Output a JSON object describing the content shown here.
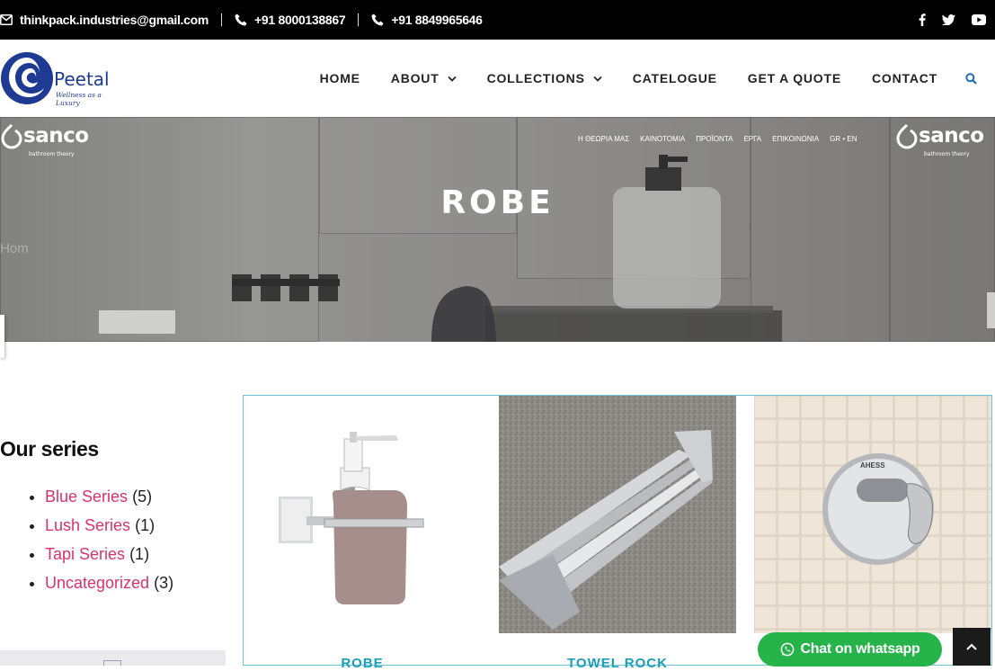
{
  "topbar": {
    "email": "thinkpack.industries@gmail.com",
    "phone1": "+91 8000138867",
    "phone2": "+91 8849965646",
    "icons": [
      "envelope-icon",
      "phone-icon",
      "phone-icon",
      "facebook-icon",
      "twitter-icon",
      "youtube-icon"
    ]
  },
  "logo": {
    "name": "Peetal",
    "tagline": "Wellness as a Luxury"
  },
  "nav": {
    "items": [
      {
        "label": "HOME",
        "dropdown": false
      },
      {
        "label": "ABOUT",
        "dropdown": true
      },
      {
        "label": "COLLECTIONS",
        "dropdown": true
      },
      {
        "label": "CATELOGUE",
        "dropdown": false
      },
      {
        "label": "GET A QUOTE",
        "dropdown": false
      },
      {
        "label": "CONTACT",
        "dropdown": false
      }
    ],
    "search_icon": "search-icon"
  },
  "hero": {
    "title": "ROBE",
    "breadcrumb": "Hom",
    "brand": "sanco",
    "brand_tag": "bathroom theory",
    "menu": [
      "Η ΘΕΩΡΙΑ ΜΑΣ",
      "ΚΑΙΝΟΤΟΜΙΑ",
      "ΠΡΟΪΟΝΤΑ",
      "ΕΡΓΑ",
      "ΕΠΙΚΟΙΝΩΝΙΑ",
      "GR • EN"
    ]
  },
  "sidebar": {
    "title": "Our series",
    "series": [
      {
        "label": "Blue Series",
        "count": "(5)"
      },
      {
        "label": "Lush Series",
        "count": "(1)"
      },
      {
        "label": "Tapi Series",
        "count": "(1)"
      },
      {
        "label": "Uncategorized",
        "count": "(3)"
      }
    ]
  },
  "products": [
    {
      "label": "ROBE"
    },
    {
      "label": "TOWEL ROCK"
    },
    {
      "label": ""
    }
  ],
  "whatsapp": {
    "label": "Chat on whatsapp"
  },
  "colors": {
    "accent_link": "#d6336c",
    "product_label": "#1a9fb6",
    "whatsapp": "#25b34a",
    "topbar": "#000000",
    "logo": "#1f3a93"
  }
}
